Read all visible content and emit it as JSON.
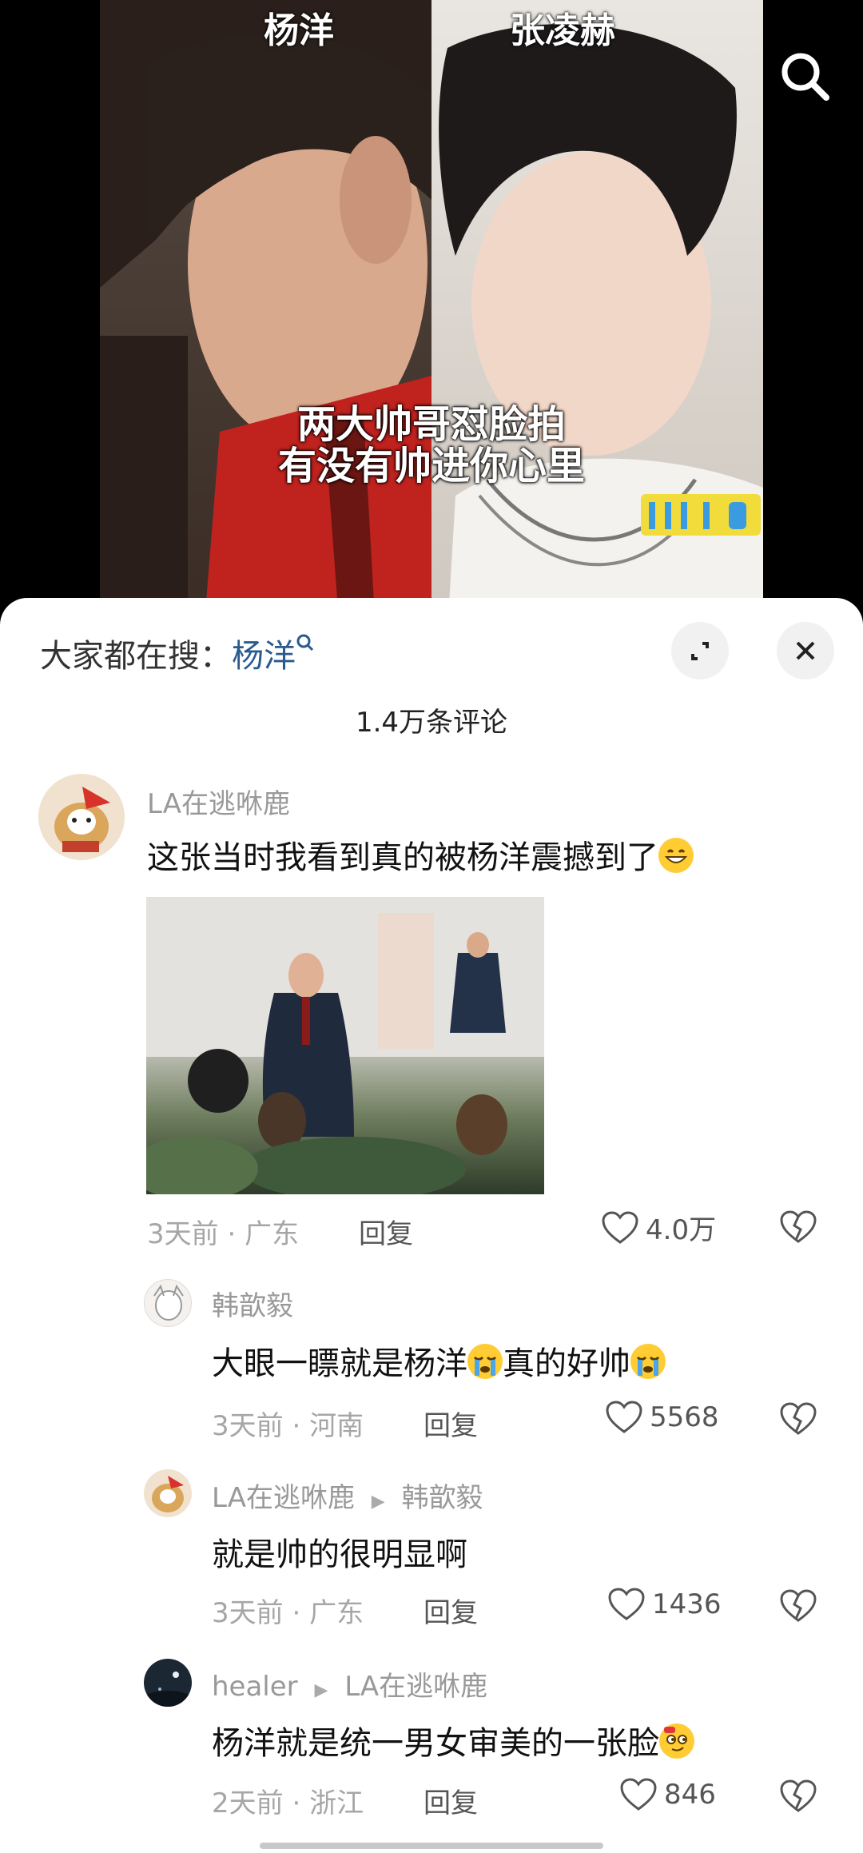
{
  "video": {
    "name_left": "杨洋",
    "name_right": "张凌赫",
    "caption_line1": "两大帅哥怼脸拍",
    "caption_line2": "有没有帅进你心里"
  },
  "sheet": {
    "hot_search_label": "大家都在搜：",
    "hot_search_keyword": "杨洋",
    "comment_count": "1.4万条评论"
  },
  "comments": [
    {
      "user": "LA在逃咻鹿",
      "text": "这张当时我看到真的被杨洋震撼到了",
      "time": "3天前",
      "location": "广东",
      "reply_label": "回复",
      "likes": "4.0万"
    }
  ],
  "replies": [
    {
      "user": "韩歆毅",
      "reply_to": "",
      "text": "大眼一瞟就是杨洋",
      "text2": "真的好帅",
      "time": "3天前",
      "location": "河南",
      "reply_label": "回复",
      "likes": "5568"
    },
    {
      "user": "LA在逃咻鹿",
      "reply_to": "韩歆毅",
      "text": "就是帅的很明显啊",
      "time": "3天前",
      "location": "广东",
      "reply_label": "回复",
      "likes": "1436"
    },
    {
      "user": "healer",
      "reply_to": "LA在逃咻鹿",
      "text": "杨洋就是统一男女审美的一张脸",
      "time": "2天前",
      "location": "浙江",
      "reply_label": "回复",
      "likes": "846"
    }
  ],
  "colors": {
    "keyword": "#2b5a8f",
    "meta": "#a6a6a6"
  }
}
